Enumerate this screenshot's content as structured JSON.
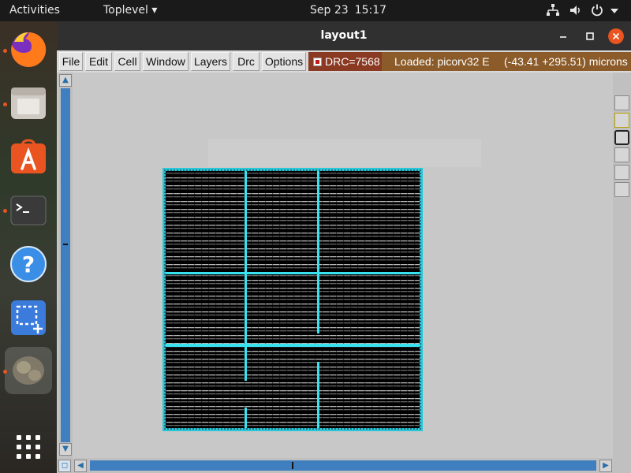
{
  "topbar": {
    "activities": "Activities",
    "app_menu": "Toplevel ▾",
    "clock_date": "Sep 23",
    "clock_time": "15:17",
    "tray_icons": [
      "network-icon",
      "volume-icon",
      "power-icon"
    ]
  },
  "dock": {
    "items": [
      {
        "name": "firefox-icon",
        "running": true
      },
      {
        "name": "files-icon",
        "running": true
      },
      {
        "name": "software-center-icon",
        "running": false
      },
      {
        "name": "terminal-icon",
        "running": true
      },
      {
        "name": "help-icon",
        "running": false
      },
      {
        "name": "screenshot-icon",
        "running": false
      },
      {
        "name": "active-app-icon",
        "running": true
      },
      {
        "name": "app-grid-icon",
        "running": false
      }
    ]
  },
  "window": {
    "title": "layout1",
    "controls": [
      "minimize-icon",
      "maximize-icon",
      "close-icon"
    ]
  },
  "menubar": {
    "items": [
      "File",
      "Edit",
      "Cell",
      "Window",
      "Layers",
      "Drc",
      "Options"
    ],
    "drc_label": "DRC=7568",
    "drc_checked": true,
    "status_loaded": "Loaded: picorv32 E",
    "status_coords": "(-43.41 +295.51) microns"
  },
  "colors": {
    "accent_orange": "#e95420",
    "drc_red": "#8a3a22",
    "status_brown": "#8b5b2a",
    "scroll_blue": "#3f7fbf",
    "layout_black": "#000000",
    "layout_cyan": "#28d7e8"
  }
}
